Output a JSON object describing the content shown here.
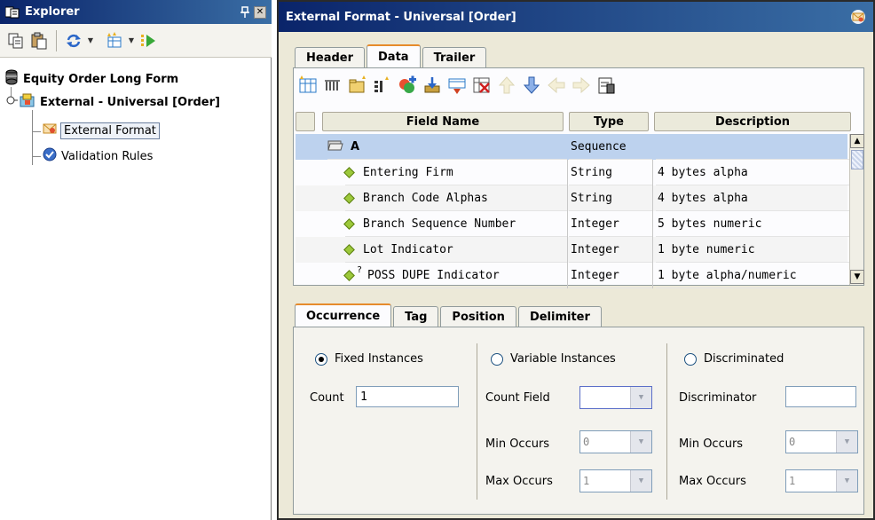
{
  "explorer": {
    "title": "Explorer",
    "tree": {
      "root": "Equity Order Long Form",
      "child": "External - Universal [Order]",
      "items": [
        "External Format",
        "Validation Rules"
      ]
    }
  },
  "window": {
    "title": "External Format - Universal [Order]"
  },
  "tabs": [
    "Header",
    "Data",
    "Trailer"
  ],
  "grid": {
    "columns": [
      "Field Name",
      "Type",
      "Description"
    ],
    "rows": [
      {
        "name": "A",
        "type": "Sequence",
        "desc": ""
      },
      {
        "name": "Entering Firm",
        "type": "String",
        "desc": "4 bytes alpha"
      },
      {
        "name": "Branch Code Alphas",
        "type": "String",
        "desc": "4 bytes alpha"
      },
      {
        "name": "Branch Sequence Number",
        "type": "Integer",
        "desc": "5 bytes numeric"
      },
      {
        "name": "Lot Indicator",
        "type": "Integer",
        "desc": "1 byte numeric"
      },
      {
        "name": "POSS DUPE Indicator",
        "type": "Integer",
        "desc": "1 byte alpha/numeric"
      }
    ]
  },
  "bottom_tabs": [
    "Occurrence",
    "Tag",
    "Position",
    "Delimiter"
  ],
  "occurrence": {
    "fixed": {
      "label": "Fixed Instances",
      "count_label": "Count",
      "count_value": "1"
    },
    "variable": {
      "label": "Variable Instances",
      "count_field_label": "Count Field",
      "min_label": "Min Occurs",
      "min_value": "0",
      "max_label": "Max Occurs",
      "max_value": "1"
    },
    "discriminated": {
      "label": "Discriminated",
      "discriminator_label": "Discriminator",
      "min_label": "Min Occurs",
      "min_value": "0",
      "max_label": "Max Occurs",
      "max_value": "1"
    }
  },
  "colors": {
    "title_start": "#0a246a",
    "title_end": "#3a6ea5",
    "selected_row": "#bdd2ee",
    "active_tab_accent": "#e68b2c"
  }
}
